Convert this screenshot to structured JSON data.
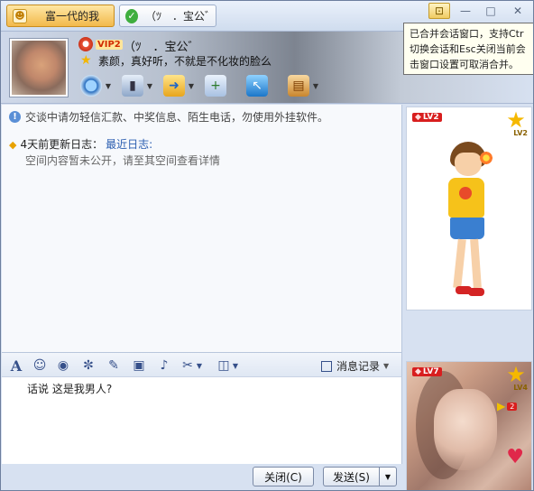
{
  "tabs": {
    "active": {
      "label": "富一代的我"
    },
    "other": {
      "label": "（ﾂ　．宝公゛"
    }
  },
  "window_controls": {
    "merge": "⊡",
    "minimize": "—",
    "maximize": "□",
    "close": "✕"
  },
  "tooltip": {
    "lines": [
      "已合并会话窗口，支持Ctr",
      "切换会话和Esc关闭当前会",
      "击窗口设置可取消合并。"
    ]
  },
  "contact": {
    "vip_label": "VIP2",
    "nickname": "（ﾂ　．宝公゛",
    "signature": "素颜，真好听，不就是不化妆的脸么"
  },
  "toolbar": {
    "items": [
      {
        "name": "video",
        "icon": "webcam-icon",
        "glyph": "◉"
      },
      {
        "name": "voice",
        "icon": "microphone-icon",
        "glyph": "♪"
      },
      {
        "name": "file",
        "icon": "folder-send-icon",
        "glyph": "➜"
      },
      {
        "name": "chat",
        "icon": "chat-add-icon",
        "glyph": "+"
      },
      {
        "name": "remote",
        "icon": "screen-icon",
        "glyph": "↖"
      },
      {
        "name": "app",
        "icon": "app-menu-icon",
        "glyph": "▤"
      }
    ]
  },
  "chat": {
    "notice": "交谈中请勿轻信汇款、中奖信息、陌生电话，勿使用外挂软件。",
    "blog_label": "4天前更新日志：",
    "blog_link": "最近日志:",
    "blog_desc": "空间内容暂未公开，请至其空间查看详情"
  },
  "input_toolbar": {
    "font_icon": "A",
    "emoji_icon": "☺",
    "history_label": "消息记录"
  },
  "input": {
    "text": "话说  这是我男人?"
  },
  "buttons": {
    "close": "关闭(C)",
    "send": "发送(S)",
    "send_menu": "▼"
  },
  "show_panel": {
    "top_level": "LV2",
    "top_star_level": "LV2",
    "bottom_level": "LV7",
    "bottom_star_level": "LV4",
    "bottom_badge": "2"
  }
}
